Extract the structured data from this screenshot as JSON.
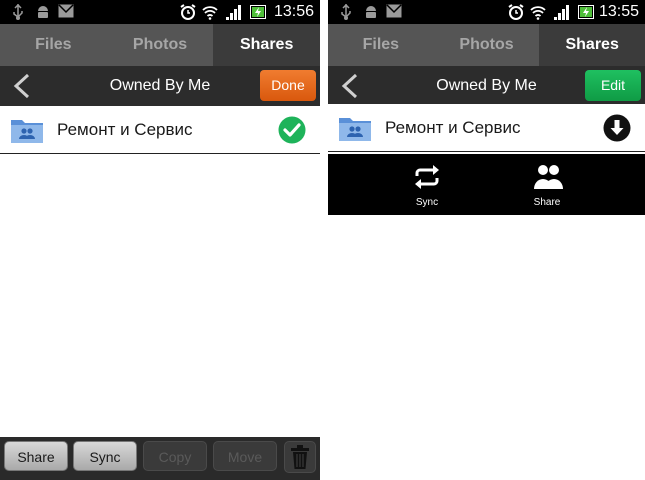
{
  "left_screen": {
    "status_bar": {
      "time": "13:56"
    },
    "tabs": [
      {
        "label": "Files",
        "active": false
      },
      {
        "label": "Photos",
        "active": false
      },
      {
        "label": "Shares",
        "active": true
      }
    ],
    "header": {
      "title": "Owned By Me",
      "action_label": "Done"
    },
    "list": [
      {
        "name": "Ремонт и Сервис",
        "status_icon": "check-circle-icon",
        "selected": true
      }
    ],
    "toolbar": {
      "share_label": "Share",
      "sync_label": "Sync",
      "copy_label": "Copy",
      "move_label": "Move",
      "copy_enabled": false,
      "move_enabled": false
    },
    "colors": {
      "done_button": "#e56a1c",
      "check": "#1eb35a"
    }
  },
  "right_screen": {
    "status_bar": {
      "time": "13:55"
    },
    "tabs": [
      {
        "label": "Files",
        "active": false
      },
      {
        "label": "Photos",
        "active": false
      },
      {
        "label": "Shares",
        "active": true
      }
    ],
    "header": {
      "title": "Owned By Me",
      "action_label": "Edit"
    },
    "list": [
      {
        "name": "Ремонт и Сервис",
        "status_icon": "download-circle-icon"
      }
    ],
    "actions": [
      {
        "label": "Sync",
        "icon": "sync-icon"
      },
      {
        "label": "Share",
        "icon": "people-icon"
      }
    ],
    "colors": {
      "edit_button": "#17ab52"
    }
  }
}
